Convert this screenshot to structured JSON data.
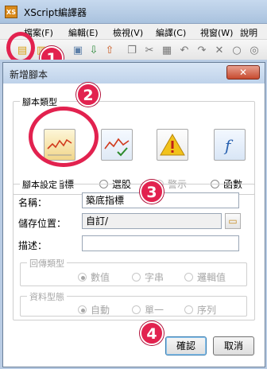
{
  "window": {
    "title": "XScript編譯器",
    "app_icon_text": "XS"
  },
  "menu": {
    "items": [
      "檔案(F)",
      "編輯(E)",
      "檢視(V)",
      "編譯(C)",
      "視窗(W)",
      "說明(H)"
    ]
  },
  "dialog": {
    "title": "新增腳本",
    "close_label": "✕",
    "script_type": {
      "group_label": "腳本類型",
      "options": [
        {
          "label": "指標",
          "selected": true,
          "enabled": true,
          "icon": "indicator-chart-icon"
        },
        {
          "label": "選股",
          "selected": false,
          "enabled": true,
          "icon": "stock-screen-icon"
        },
        {
          "label": "警示",
          "selected": false,
          "enabled": false,
          "icon": "warning-icon"
        },
        {
          "label": "函數",
          "selected": false,
          "enabled": true,
          "icon": "function-icon"
        }
      ]
    },
    "settings": {
      "group_label": "腳本設定",
      "name_label": "名稱：",
      "name_value": "築底指標",
      "location_label": "儲存位置：",
      "location_value": "自訂/",
      "desc_label": "描述：",
      "desc_value": "",
      "return_group": {
        "label": "回傳類型",
        "options": [
          {
            "label": "數值",
            "selected": true
          },
          {
            "label": "字串",
            "selected": false
          },
          {
            "label": "邏輯值",
            "selected": false
          }
        ]
      },
      "data_group": {
        "label": "資料型態",
        "options": [
          {
            "label": "自動",
            "selected": true
          },
          {
            "label": "單一",
            "selected": false
          },
          {
            "label": "序列",
            "selected": false
          }
        ]
      }
    },
    "buttons": {
      "ok": "確認",
      "cancel": "取消"
    }
  },
  "annotations": {
    "step1": "1",
    "step2": "2",
    "step3": "3",
    "step4": "4"
  },
  "colors": {
    "annotation": "#e2224f",
    "dialog_border": "#6a7f99"
  }
}
